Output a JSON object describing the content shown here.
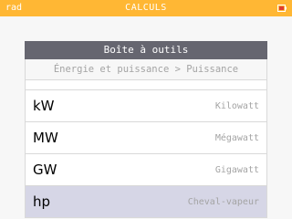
{
  "status_bar": {
    "angle_mode": "rad",
    "app_title": "CALCULS",
    "battery_icon": "battery-icon"
  },
  "toolbox": {
    "title": "Boîte à outils",
    "breadcrumb": "Énergie et puissance > Puissance",
    "items": [
      {
        "symbol": "kW",
        "name": "Kilowatt",
        "selected": false
      },
      {
        "symbol": "MW",
        "name": "Mégawatt",
        "selected": false
      },
      {
        "symbol": "GW",
        "name": "Gigawatt",
        "selected": false
      },
      {
        "symbol": "hp",
        "name": "Cheval-vapeur",
        "selected": true
      }
    ]
  },
  "colors": {
    "status_bar": "#ffb734",
    "header": "#666670",
    "selected_row": "#d6d6e6",
    "muted_text": "#a4a4a4"
  }
}
